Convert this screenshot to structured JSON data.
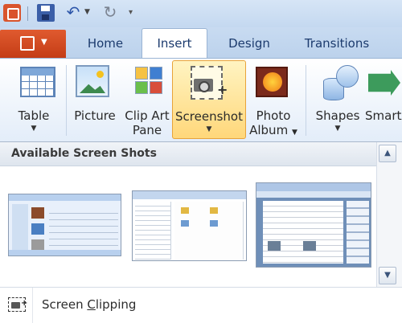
{
  "tabs": [
    {
      "label": "Home"
    },
    {
      "label": "Insert",
      "active": true
    },
    {
      "label": "Design"
    },
    {
      "label": "Transitions"
    }
  ],
  "ribbon": {
    "table": {
      "label": "Table"
    },
    "picture": {
      "label": "Picture"
    },
    "clipart": {
      "line1": "Clip Art",
      "line2": "Pane"
    },
    "screenshot": {
      "label": "Screenshot",
      "active": true
    },
    "photo_album": {
      "line1": "Photo",
      "line2": "Album"
    },
    "shapes": {
      "label": "Shapes"
    },
    "smartart": {
      "label": "SmartA"
    }
  },
  "dropdown": {
    "header": "Available Screen Shots",
    "thumbnails": [
      "screenshot-1",
      "screenshot-2",
      "screenshot-3"
    ],
    "clipping_label_prefix": "Screen ",
    "clipping_label_mnemonic": "C",
    "clipping_label_suffix": "lipping"
  },
  "colors": {
    "file_tab": "#d24a21",
    "active_button": "#ffd77a",
    "tab_text": "#1c3b6e"
  },
  "icons": {
    "app": "powerpoint-icon",
    "save": "save-icon",
    "undo": "undo-icon",
    "redo": "redo-icon",
    "clip": "screen-clipping-icon"
  }
}
